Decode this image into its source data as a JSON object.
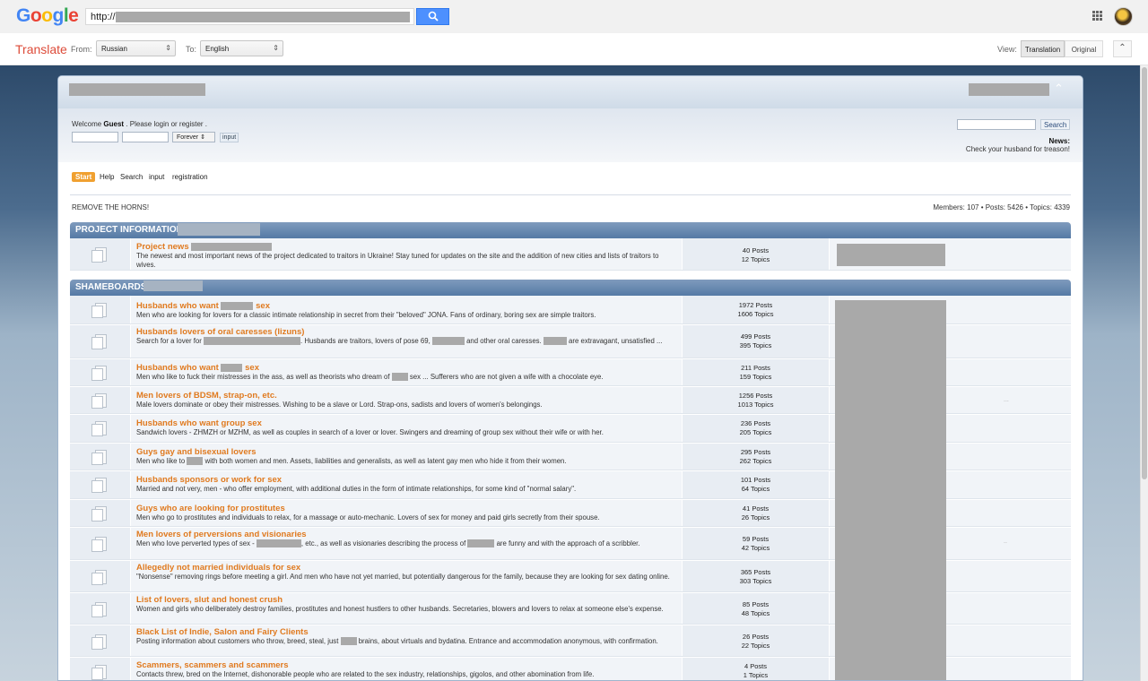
{
  "google": {
    "logo_letters": [
      {
        "ch": "G",
        "color": "#4285f4"
      },
      {
        "ch": "o",
        "color": "#ea4335"
      },
      {
        "ch": "o",
        "color": "#fbbc05"
      },
      {
        "ch": "g",
        "color": "#4285f4"
      },
      {
        "ch": "l",
        "color": "#34a853"
      },
      {
        "ch": "e",
        "color": "#ea4335"
      }
    ],
    "url_prefix": "http://",
    "search_icon": "magnifier-icon",
    "apps_icon": "apps-grid-icon"
  },
  "translate_bar": {
    "title": "Translate",
    "from_label": "From:",
    "from_value": "Russian",
    "to_label": "To:",
    "to_value": "English",
    "view_label": "View:",
    "view_translation": "Translation",
    "view_original": "Original",
    "collapse_icon": "double-chevron-up-icon"
  },
  "forum": {
    "welcome_prefix": "Welcome ",
    "guest": "Guest",
    "welcome_suffix": " . Please login or register .",
    "forever": "Forever",
    "input_btn": "input",
    "search_btn": "Search",
    "news_label": "News:",
    "news_text": "Check your husband for treason!",
    "nav": [
      "Start",
      "Help",
      "Search",
      "input",
      "registration"
    ],
    "motto": "REMOVE THE HORNS!",
    "stats": "Members: 107 • Posts: 5426 • Topics: 4339"
  },
  "categories": [
    {
      "title": "PROJECT INFORMATION",
      "boards": [
        {
          "title": "Project news",
          "desc": "The newest and most important news of the project dedicated to traitors in Ukraine! Stay tuned for updates on the site and the addition of new cities and lists of traitors to wives.",
          "posts": "40 Posts",
          "topics": "12 Topics"
        }
      ]
    },
    {
      "title": "SHAMEBOARDS",
      "boards": [
        {
          "title_a": "Husbands who want ",
          "title_b": " sex",
          "desc": "Men who are looking for lovers for a classic intimate relationship in secret from their \"beloved\" JONA. Fans of ordinary, boring sex are simple traitors.",
          "posts": "1972 Posts",
          "topics": "1606 Topics"
        },
        {
          "title": "Husbands lovers of oral caresses (lizuns)",
          "desc_a": "Search for a lover for ",
          "desc_b": ". Husbands are traitors, lovers of pose 69, ",
          "desc_c": " and other oral caresses. ",
          "desc_d": " are extravagant, unsatisfied ...",
          "posts": "499 Posts",
          "topics": "395 Topics"
        },
        {
          "title_a": "Husbands who want ",
          "title_b": " sex",
          "desc_a": "Men who like to fuck their mistresses in the ass, as well as theorists who dream of ",
          "desc_b": " sex ... Sufferers who are not given a wife with a chocolate eye.",
          "posts": "211 Posts",
          "topics": "159 Topics"
        },
        {
          "title": "Men lovers of BDSM, strap-on, etc.",
          "desc": "Male lovers dominate or obey their mistresses. Wishing to be a slave or Lord. Strap-ons, sadists and lovers of women's belongings.",
          "posts": "1256 Posts",
          "topics": "1013 Topics"
        },
        {
          "title": "Husbands who want group sex",
          "desc": "Sandwich lovers - ZHMZH or MZHM, as well as couples in search of a lover or lover. Swingers and dreaming of group sex without their wife or with her.",
          "posts": "236 Posts",
          "topics": "205 Topics"
        },
        {
          "title": "Guys gay and bisexual lovers",
          "desc_a": "Men who like to ",
          "desc_b": " with both women and men. Assets, liabilities and generalists, as well as latent gay men who hide it from their women.",
          "posts": "295 Posts",
          "topics": "262 Topics"
        },
        {
          "title": "Husbands sponsors or work for sex",
          "desc": "Married and not very, men - who offer employment, with additional duties in the form of intimate relationships, for some kind of \"normal salary\".",
          "posts": "101 Posts",
          "topics": "64 Topics"
        },
        {
          "title": "Guys who are looking for prostitutes",
          "desc": "Men who go to prostitutes and individuals to relax, for a massage or auto-mechanic. Lovers of sex for money and paid girls secretly from their spouse.",
          "posts": "41 Posts",
          "topics": "26 Topics"
        },
        {
          "title": "Men lovers of perversions and visionaries",
          "desc_a": "Men who love perverted types of sex - ",
          "desc_b": ", etc., as well as visionaries describing the process of ",
          "desc_c": " are funny and with the approach of a scribbler.",
          "posts": "59 Posts",
          "topics": "42 Topics"
        },
        {
          "title": "Allegedly not married individuals for sex",
          "desc": "\"Nonsense\" removing rings before meeting a girl. And men who have not yet married, but potentially dangerous for the family, because they are looking for sex dating online.",
          "posts": "365 Posts",
          "topics": "303 Topics"
        },
        {
          "title": "List of lovers, slut and honest crush",
          "desc": "Women and girls who deliberately destroy families, prostitutes and honest hustlers to other husbands. Secretaries, blowers and lovers to relax at someone else's expense.",
          "posts": "85 Posts",
          "topics": "48 Topics"
        },
        {
          "title": "Black List of Indie, Salon and Fairy Clients",
          "desc_a": "Posting information about customers who throw, breed, steal, just ",
          "desc_b": " brains, about virtuals and bydatina. Entrance and accommodation anonymous, with confirmation.",
          "posts": "26 Posts",
          "topics": "22 Topics"
        },
        {
          "title": "Scammers, scammers and scammers",
          "desc": "Contacts threw, bred on the Internet, dishonorable people who are related to the sex industry, relationships, gigolos, and other abomination from life.",
          "posts": "4 Posts",
          "topics": "1 Topics"
        }
      ]
    }
  ]
}
